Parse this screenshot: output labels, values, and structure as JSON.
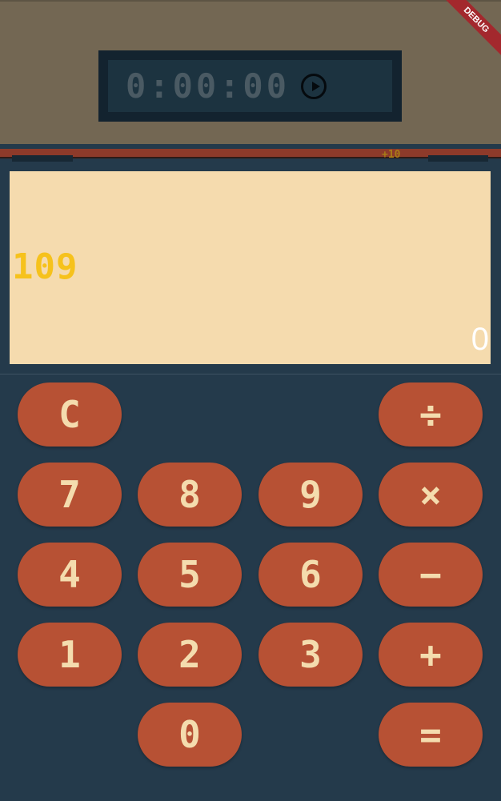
{
  "timer": {
    "text": "0:00:00",
    "icon": "play-circle-icon"
  },
  "debug_banner": "DEBUG",
  "bonus": "+10",
  "display": {
    "value": "109",
    "result": "0"
  },
  "keypad": {
    "clear": "C",
    "divide": "÷",
    "seven": "7",
    "eight": "8",
    "nine": "9",
    "multiply": "×",
    "four": "4",
    "five": "5",
    "six": "6",
    "minus": "−",
    "one": "1",
    "two": "2",
    "three": "3",
    "plus": "+",
    "zero": "0",
    "equals": "="
  },
  "colors": {
    "top_bar": "#736753",
    "background": "#243a4b",
    "display_bg": "#f5dbae",
    "display_value": "#f6c21c",
    "key_bg": "#b75134",
    "key_text": "#f4dcae"
  }
}
